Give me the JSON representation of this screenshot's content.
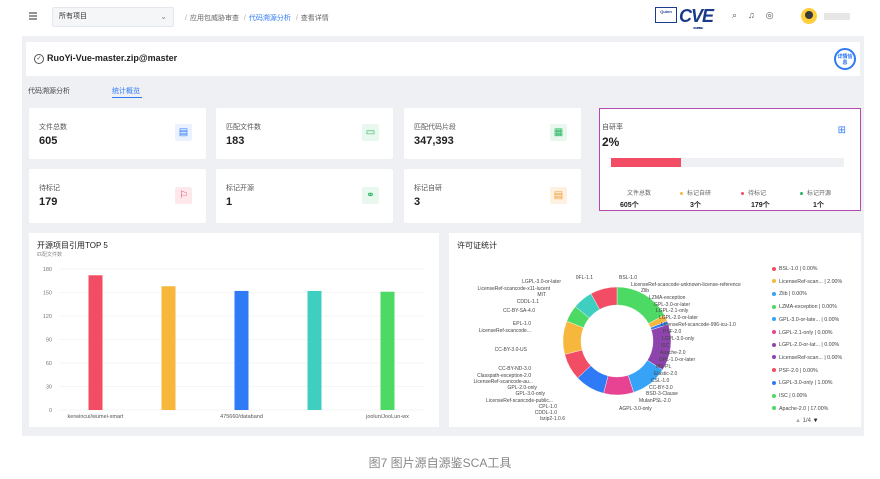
{
  "topbar": {
    "project_select": "所有项目",
    "breadcrumb": [
      "应用包威胁审查",
      "代码溯源分析",
      "查看详情"
    ],
    "logo_a": "Quinn",
    "logo_b": "CVE",
    "logo_b_sub": "COMPATIBLE"
  },
  "header": {
    "title": "RuoYi-Vue-master.zip@master",
    "detail_button": "详情信息"
  },
  "tabs": [
    {
      "label": "代码溯源分析"
    },
    {
      "label": "统计概览"
    }
  ],
  "stats": [
    {
      "label": "文件总数",
      "value": "605",
      "icon": "file-icon",
      "color": "blue"
    },
    {
      "label": "匹配文件数",
      "value": "183",
      "icon": "folder-icon",
      "color": "green"
    },
    {
      "label": "匹配代码片段",
      "value": "347,393",
      "icon": "code-icon",
      "color": "green"
    },
    {
      "label": "待标记",
      "value": "179",
      "icon": "flag-icon",
      "color": "pink"
    },
    {
      "label": "标记开源",
      "value": "1",
      "icon": "link-icon",
      "color": "green"
    },
    {
      "label": "标记自研",
      "value": "3",
      "icon": "doc-icon",
      "color": "orange"
    }
  ],
  "self_rate": {
    "label": "自研率",
    "value": "2%",
    "progress_fraction": 0.3,
    "legend": [
      {
        "label": "文件总数",
        "value": "605个",
        "color": "#ffffff"
      },
      {
        "label": "标记自研",
        "value": "3个",
        "color": "#f6b73c"
      },
      {
        "label": "待标记",
        "value": "179个",
        "color": "#f24d64"
      },
      {
        "label": "标记开源",
        "value": "1个",
        "color": "#27b35f"
      }
    ]
  },
  "top5": {
    "title": "开源项目引用TOP 5",
    "subtitle": "匹配文件数"
  },
  "license": {
    "title": "许可证统计",
    "callouts": [
      "0FL-1.1",
      "BSL-1.0",
      "LicenseRef-scancode-unknown-license-reference",
      "Zlib",
      "LZMA-exception",
      "GPL-3.0-or-later",
      "LGPL-2.1-only",
      "LGPL-2.0-or-later",
      "LicenseRef-scancode-996-icu-1.0",
      "PSF-2.0",
      "LGPL-3.0-only",
      "ISC",
      "Apache-2.0",
      "GPL-1.0-or-later",
      "MS-PL",
      "Elastic-2.0",
      "CSL-1.0",
      "CC-BY-3.0",
      "BSD-3-Clause",
      "MulanPSL-2.0",
      "AGPL-3.0-only",
      "LGPL-3.0-or-later",
      "LicenseRef-scancode-x11-lucent",
      "MIT",
      "CDDL-1.1",
      "CC-BY-SA-4.0",
      "EPL-1.0",
      "LicenseRef-scancode...",
      "CC-BY-3.0-US",
      "CC-BY-ND-3.0",
      "Classpath-exception-2.0",
      "LicenseRef-scancode-au...",
      "GPL-2.0-only",
      "GPL-3.0-only",
      "LicenseRef-scancode-public...",
      "CPL-1.0",
      "CDDL-1.0",
      "bzip2-1.0.6"
    ],
    "legend": [
      {
        "label": "BSL-1.0 | 0.00%",
        "color": "#f24d64"
      },
      {
        "label": "LicenseRef-scan... | 2.00%",
        "color": "#f6b73c"
      },
      {
        "label": "Zlib | 0.00%",
        "color": "#36a3f7"
      },
      {
        "label": "LZMA-exception | 0.00%",
        "color": "#4cd964"
      },
      {
        "label": "GPL-3.0-or-late... | 0.00%",
        "color": "#36a3f7"
      },
      {
        "label": "LGPL-2.1-only | 0.00%",
        "color": "#e84393"
      },
      {
        "label": "LGPL-2.0-or-lat... | 0.00%",
        "color": "#8e44ad"
      },
      {
        "label": "LicenseRef-scan... | 0.00%",
        "color": "#8e44ad"
      },
      {
        "label": "PSF-2.0 | 0.00%",
        "color": "#f24d64"
      },
      {
        "label": "LGPL-3.0-only | 1.00%",
        "color": "#2f7bf5"
      },
      {
        "label": "ISC | 0.00%",
        "color": "#4cd964"
      },
      {
        "label": "Apache-2.0 | 17.00%",
        "color": "#4cd964"
      }
    ],
    "page": "1/4"
  },
  "caption": "图7 图片源自源鉴SCA工具",
  "chart_data": [
    {
      "type": "bar",
      "title": "开源项目引用TOP 5",
      "ylabel": "匹配文件数",
      "categories": [
        "kerwincui/wumei-smart",
        "",
        "475660/databand",
        "",
        "joolun/JooLun-wx"
      ],
      "values": [
        172,
        158,
        152,
        152,
        151
      ],
      "colors": [
        "#f24d64",
        "#f6b73c",
        "#2f7bf5",
        "#3fcfc0",
        "#4cd964"
      ],
      "yticks": [
        0,
        30,
        60,
        90,
        120,
        150,
        180
      ],
      "ylim": [
        0,
        180
      ]
    },
    {
      "type": "pie",
      "title": "许可证统计",
      "slices": [
        {
          "label": "Apache-2.0",
          "value": 17,
          "color": "#4cd964"
        },
        {
          "label": "LicenseRef-scan...",
          "value": 2,
          "color": "#f6b73c"
        },
        {
          "label": "LGPL-3.0-only",
          "value": 1,
          "color": "#2f7bf5"
        },
        {
          "label": "MIT",
          "value": 14,
          "color": "#8e44ad"
        },
        {
          "label": "GPL-2.0-only",
          "value": 11,
          "color": "#36a3f7"
        },
        {
          "label": "EPL-1.0",
          "value": 9,
          "color": "#e84393"
        },
        {
          "label": "CC-BY-3.0-US",
          "value": 9,
          "color": "#2f7bf5"
        },
        {
          "label": "LGPL-2.1-only",
          "value": 8,
          "color": "#f24d64"
        },
        {
          "label": "BSD-3-Clause",
          "value": 10,
          "color": "#f6b73c"
        },
        {
          "label": "CDDL-1.0",
          "value": 5,
          "color": "#4cd964"
        },
        {
          "label": "BSL-1.0",
          "value": 6,
          "color": "#3fcfc0"
        },
        {
          "label": "MulanPSL-2.0",
          "value": 8,
          "color": "#f24d64"
        }
      ]
    }
  ]
}
